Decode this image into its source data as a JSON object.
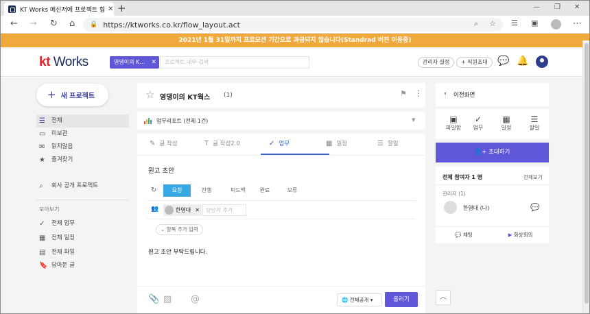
{
  "browser": {
    "tab_title": "KT Works 메신저에 프로젝트 협",
    "url": "https://ktworks.co.kr/flow_layout.act"
  },
  "promo": "2021년 1월 31일까지 프로모션 기간으로 과금되지 않습니다(Standrad 버전 이용중)",
  "header": {
    "logo_kt": "kt",
    "logo_works": "Works",
    "chip": "영댕이의 K…",
    "search_placeholder": "프로젝트 내부 검색",
    "admin": "관리자 설정",
    "invite": "직원초대"
  },
  "sidebar": {
    "new_project": "새 프로젝트",
    "items": [
      {
        "label": "전체",
        "icon": "list-icon"
      },
      {
        "label": "미보관",
        "icon": "inbox-icon"
      },
      {
        "label": "읽지않음",
        "icon": "mail-icon"
      },
      {
        "label": "즐겨찾기",
        "icon": "star-icon"
      }
    ],
    "company": "회사 공개 프로젝트",
    "section": "모아보기",
    "views": [
      {
        "label": "전체 업무",
        "icon": "check-icon"
      },
      {
        "label": "전체 일정",
        "icon": "calendar-icon"
      },
      {
        "label": "전체 파일",
        "icon": "file-icon"
      },
      {
        "label": "담아둔 글",
        "icon": "bookmark-icon"
      }
    ]
  },
  "project": {
    "title": "영댕이의 KT웍스",
    "count": "(1)",
    "report": "업무리포트 (전체 1건)"
  },
  "compose": {
    "tabs": [
      "글 작성",
      "글 작성2.0",
      "업무",
      "일정",
      "할일"
    ],
    "active_tab": "업무",
    "task_title": "원고 초안",
    "statuses": [
      "요청",
      "진행",
      "피드백",
      "완료",
      "보류"
    ],
    "assignee": "한영대",
    "assign_placeholder": "담당자 추가",
    "add_fields": "항목 추가 입력",
    "body": "원고 초안 부탁드립니다.",
    "visibility": "전체공개",
    "post": "올리기"
  },
  "right_panel": {
    "back": "이전화면",
    "icons": [
      "파일함",
      "업무",
      "일정",
      "할일"
    ],
    "invite": "초대하기",
    "participants": "전체 참여자 1 명",
    "view_all": "전체보기",
    "admin_label": "관리자 (1)",
    "member": "한영대 (나)",
    "chat": "채팅",
    "video": "화상회의"
  }
}
